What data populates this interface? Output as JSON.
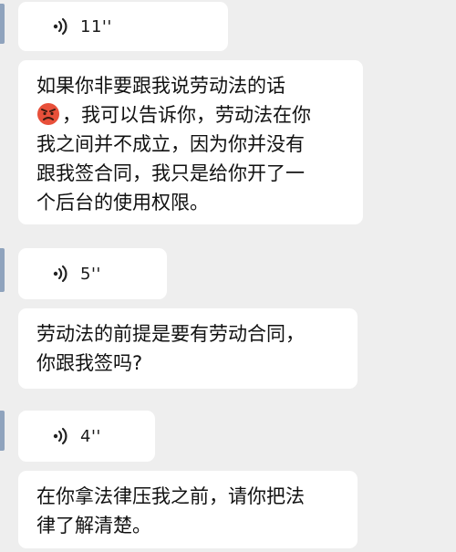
{
  "messages": [
    {
      "type": "voice",
      "duration": "11''"
    },
    {
      "type": "text",
      "line1": "如果你非要跟我说劳动法的话",
      "emoji": "angry-face-emoji",
      "line2_after_emoji": "，我可以告诉你，劳动法在你",
      "line3": "我之间并不成立，因为你并没有",
      "line4": "跟我签合同，我只是给你开了一",
      "line5": "个后台的使用权限。"
    },
    {
      "type": "voice",
      "duration": "5''"
    },
    {
      "type": "text",
      "line1": "劳动法的前提是要有劳动合同，",
      "line2": "你跟我签吗?"
    },
    {
      "type": "voice",
      "duration": "4''"
    },
    {
      "type": "text",
      "line1": "在你拿法律压我之前，请你把法",
      "line2": "律了解清楚。"
    }
  ],
  "colors": {
    "background": "#eeeeee",
    "bubble": "#ffffff",
    "text": "#111111",
    "avatar_edge": "#8fa3bd"
  }
}
